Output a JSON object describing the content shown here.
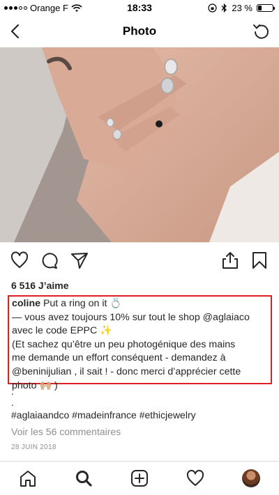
{
  "status_bar": {
    "carrier": "Orange F",
    "time": "18:33",
    "battery": "23 %",
    "battery_level": 0.23
  },
  "nav": {
    "title": "Photo"
  },
  "post": {
    "likes": "6 516 J’aime",
    "caption": {
      "username": "coline",
      "line1": " Put a ring on it 💍",
      "line2": "— vous avez toujours 10% sur tout le shop @aglaiaco",
      "line3": "avec le code EPPC ✨",
      "line4": "(Et sachez qu’être un peu photogénique des mains",
      "line5": "me demande un effort conséquent - demandez à",
      "line6": "@beninijulian , il sait ! - donc merci d’apprécier cette",
      "line7": "photo 🙌🏼 )"
    },
    "dot1": ".",
    "dot2": ".",
    "hashtags": "#aglaiaandco #madeinfrance #ethicjewelry",
    "comments_link": "Voir les 56 commentaires",
    "date": "28 JUIN 2018"
  },
  "icons": {
    "back": "chevron-left-icon",
    "refresh": "refresh-icon",
    "like": "heart-icon",
    "comment": "comment-icon",
    "share": "send-icon",
    "upload": "share-upload-icon",
    "save": "bookmark-icon",
    "tabs": [
      "home-icon",
      "search-icon",
      "add-icon",
      "activity-icon",
      "profile-avatar"
    ]
  },
  "colors": {
    "highlight_border": "#e02020",
    "muted_text": "#8e8e8e",
    "text": "#262626"
  }
}
